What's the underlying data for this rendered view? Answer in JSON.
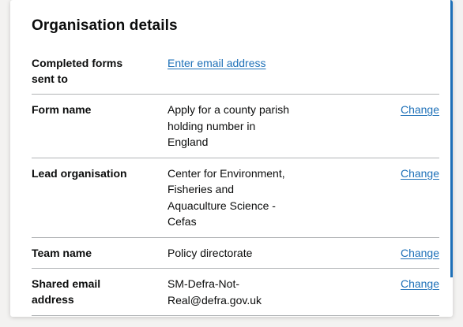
{
  "section": {
    "title": "Organisation details"
  },
  "rows": [
    {
      "key": "Completed forms sent to",
      "value": "Enter email address",
      "value_is_link": true,
      "action": ""
    },
    {
      "key": "Form name",
      "value": "Apply for a county parish holding number in England",
      "action": "Change"
    },
    {
      "key": "Lead organisation",
      "value": "Center for Environment, Fisheries and Aquaculture Science - Cefas",
      "action": "Change"
    },
    {
      "key": "Team name",
      "value": "Policy directorate",
      "action": "Change"
    },
    {
      "key": "Shared email address",
      "value": "SM-Defra-Not-Real@defra.gov.uk",
      "action": "Change"
    }
  ],
  "colors": {
    "link": "#1d70b8",
    "text": "#0b0c0c",
    "divider": "#b1b4b6"
  }
}
